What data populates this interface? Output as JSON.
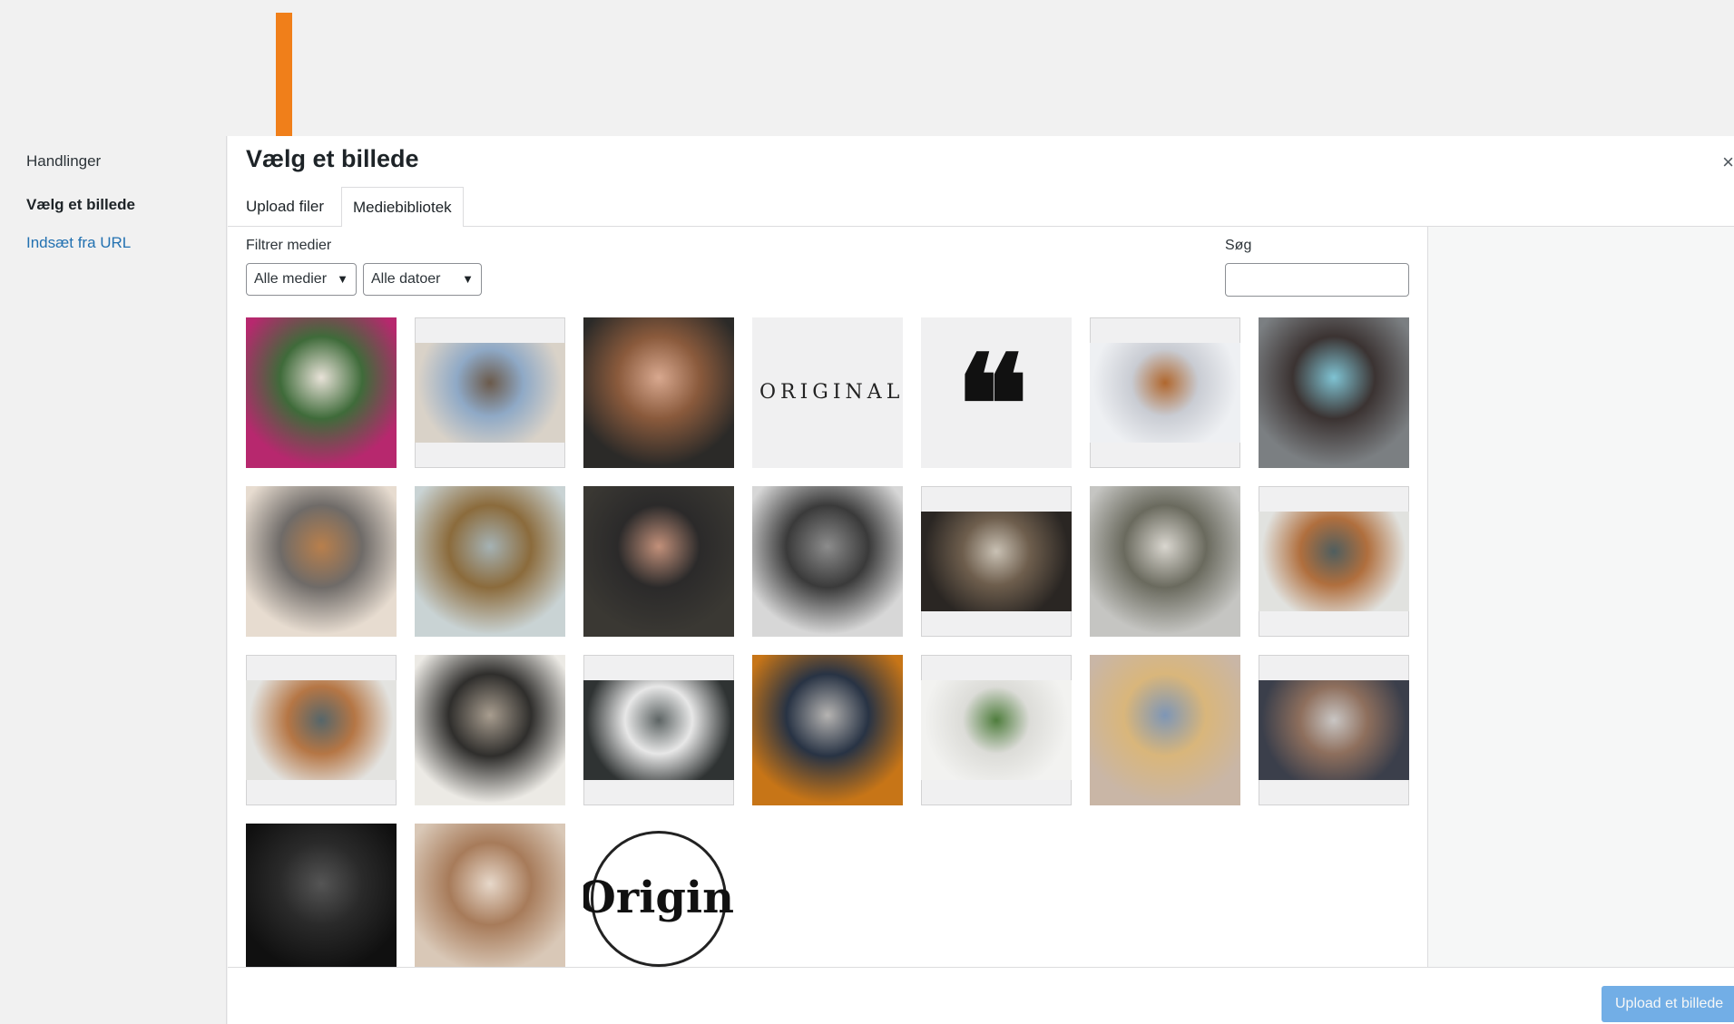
{
  "menu": {
    "heading": "Handlinger",
    "active_item": "Vælg et billede",
    "url_link": "Indsæt fra URL"
  },
  "frame": {
    "title": "Vælg et billede",
    "close_glyph": "×"
  },
  "router": {
    "upload_tab": "Upload filer",
    "library_tab": "Mediebibliotek"
  },
  "filters": {
    "label": "Filtrer medier",
    "media_type": "Alle medier",
    "dates": "Alle datoer",
    "chevron_icon": "chevron-down-icon"
  },
  "search": {
    "label": "Søg",
    "value": ""
  },
  "attachments": [
    {
      "name": "tulips-photo",
      "colors": [
        "#b7286e",
        "#3f6b3a",
        "#e8e2d8"
      ],
      "wide": false
    },
    {
      "name": "woman-chair-photo",
      "colors": [
        "#d9d2c8",
        "#8fa9c6",
        "#6b5a4b"
      ],
      "wide": true
    },
    {
      "name": "woman-portrait-photo",
      "colors": [
        "#2b2a28",
        "#8a5a3c",
        "#d8a88f"
      ],
      "wide": false
    },
    {
      "name": "original-logo",
      "colors": [
        "#f0f0f1"
      ],
      "wide": false,
      "text": "ORIGINAL"
    },
    {
      "name": "quote-mark",
      "colors": [
        "#f0f0f1"
      ],
      "wide": false,
      "glyph": "❝"
    },
    {
      "name": "headphones-photo",
      "colors": [
        "#eef0f3",
        "#c9ccd3",
        "#b0672e"
      ],
      "wide": true
    },
    {
      "name": "woman-glasses-photo",
      "colors": [
        "#7b7f82",
        "#3b3332",
        "#7fc3d3"
      ],
      "wide": false
    },
    {
      "name": "city-skyline-photo",
      "colors": [
        "#e7dcd0",
        "#6f6b68",
        "#b87f4c"
      ],
      "wide": false
    },
    {
      "name": "bridge-photo",
      "colors": [
        "#c9d3d4",
        "#8b6b3c",
        "#a5b2b4"
      ],
      "wide": false
    },
    {
      "name": "woman-smiling-photo",
      "colors": [
        "#3a3833",
        "#2b2a2a",
        "#c2907a"
      ],
      "wide": false
    },
    {
      "name": "woman-bw-photo",
      "colors": [
        "#d7d7d7",
        "#3a3a3a",
        "#8c8c8c"
      ],
      "wide": false
    },
    {
      "name": "desk-plants-photo",
      "colors": [
        "#2a2623",
        "#6e5e4d",
        "#c9c1b4"
      ],
      "wide": true
    },
    {
      "name": "air-plant-photo",
      "colors": [
        "#c5c5c2",
        "#6a6a5e",
        "#d9d6cf"
      ],
      "wide": false
    },
    {
      "name": "living-room-photo",
      "colors": [
        "#e1e2df",
        "#b06f3e",
        "#4f5e5f"
      ],
      "wide": true
    },
    {
      "name": "living-room-2-photo",
      "colors": [
        "#e3e3e0",
        "#b57645",
        "#56666a"
      ],
      "wide": true
    },
    {
      "name": "workspace-photo",
      "colors": [
        "#eceae5",
        "#2f2e2c",
        "#a89d8f"
      ],
      "wide": false
    },
    {
      "name": "glass-plant-photo",
      "colors": [
        "#2f3333",
        "#e7e7e7",
        "#5d6464"
      ],
      "wide": true
    },
    {
      "name": "orange-sweater-photo",
      "colors": [
        "#c77517",
        "#283344",
        "#b6b4b2"
      ],
      "wide": false
    },
    {
      "name": "vases-photo",
      "colors": [
        "#f2f2f0",
        "#dcdcd8",
        "#4f7d3d"
      ],
      "wide": true
    },
    {
      "name": "woman-blonde-photo",
      "colors": [
        "#c9b6a6",
        "#d9b67b",
        "#7e96b6"
      ],
      "wide": false
    },
    {
      "name": "mountain-lake-photo",
      "colors": [
        "#3b3f4b",
        "#8e6f5d",
        "#c9c6c4"
      ],
      "wide": true
    },
    {
      "name": "phone-photo",
      "colors": [
        "#101010",
        "#2a2a2a",
        "#555"
      ],
      "wide": false
    },
    {
      "name": "hand-ring-photo",
      "colors": [
        "#d9c8b7",
        "#a77b5a",
        "#e7d8ca"
      ],
      "wide": false
    },
    {
      "name": "original-circle-logo",
      "colors": [
        "#ffffff"
      ],
      "wide": false,
      "text": "Original"
    }
  ],
  "toolbar": {
    "select_button": "Upload et billede"
  },
  "annotation": {
    "arrow_color": "#f07f1a"
  }
}
